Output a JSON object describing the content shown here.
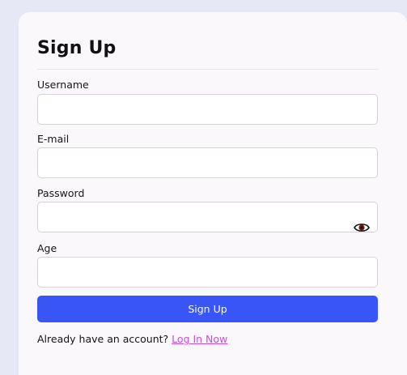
{
  "form": {
    "title": "Sign Up",
    "fields": {
      "username": {
        "label": "Username",
        "value": "",
        "placeholder": ""
      },
      "email": {
        "label": "E-mail",
        "value": "",
        "placeholder": ""
      },
      "password": {
        "label": "Password",
        "value": "",
        "placeholder": "",
        "toggle_icon": "eye-icon"
      },
      "age": {
        "label": "Age",
        "value": "",
        "placeholder": ""
      }
    },
    "submit_label": "Sign Up",
    "footer": {
      "prompt": "Already have an account?",
      "link_label": "Log In Now"
    }
  },
  "colors": {
    "background": "#e6e8f6",
    "card": "#fbf8fb",
    "primary_button": "#3a55f5",
    "link": "#c54de6"
  }
}
